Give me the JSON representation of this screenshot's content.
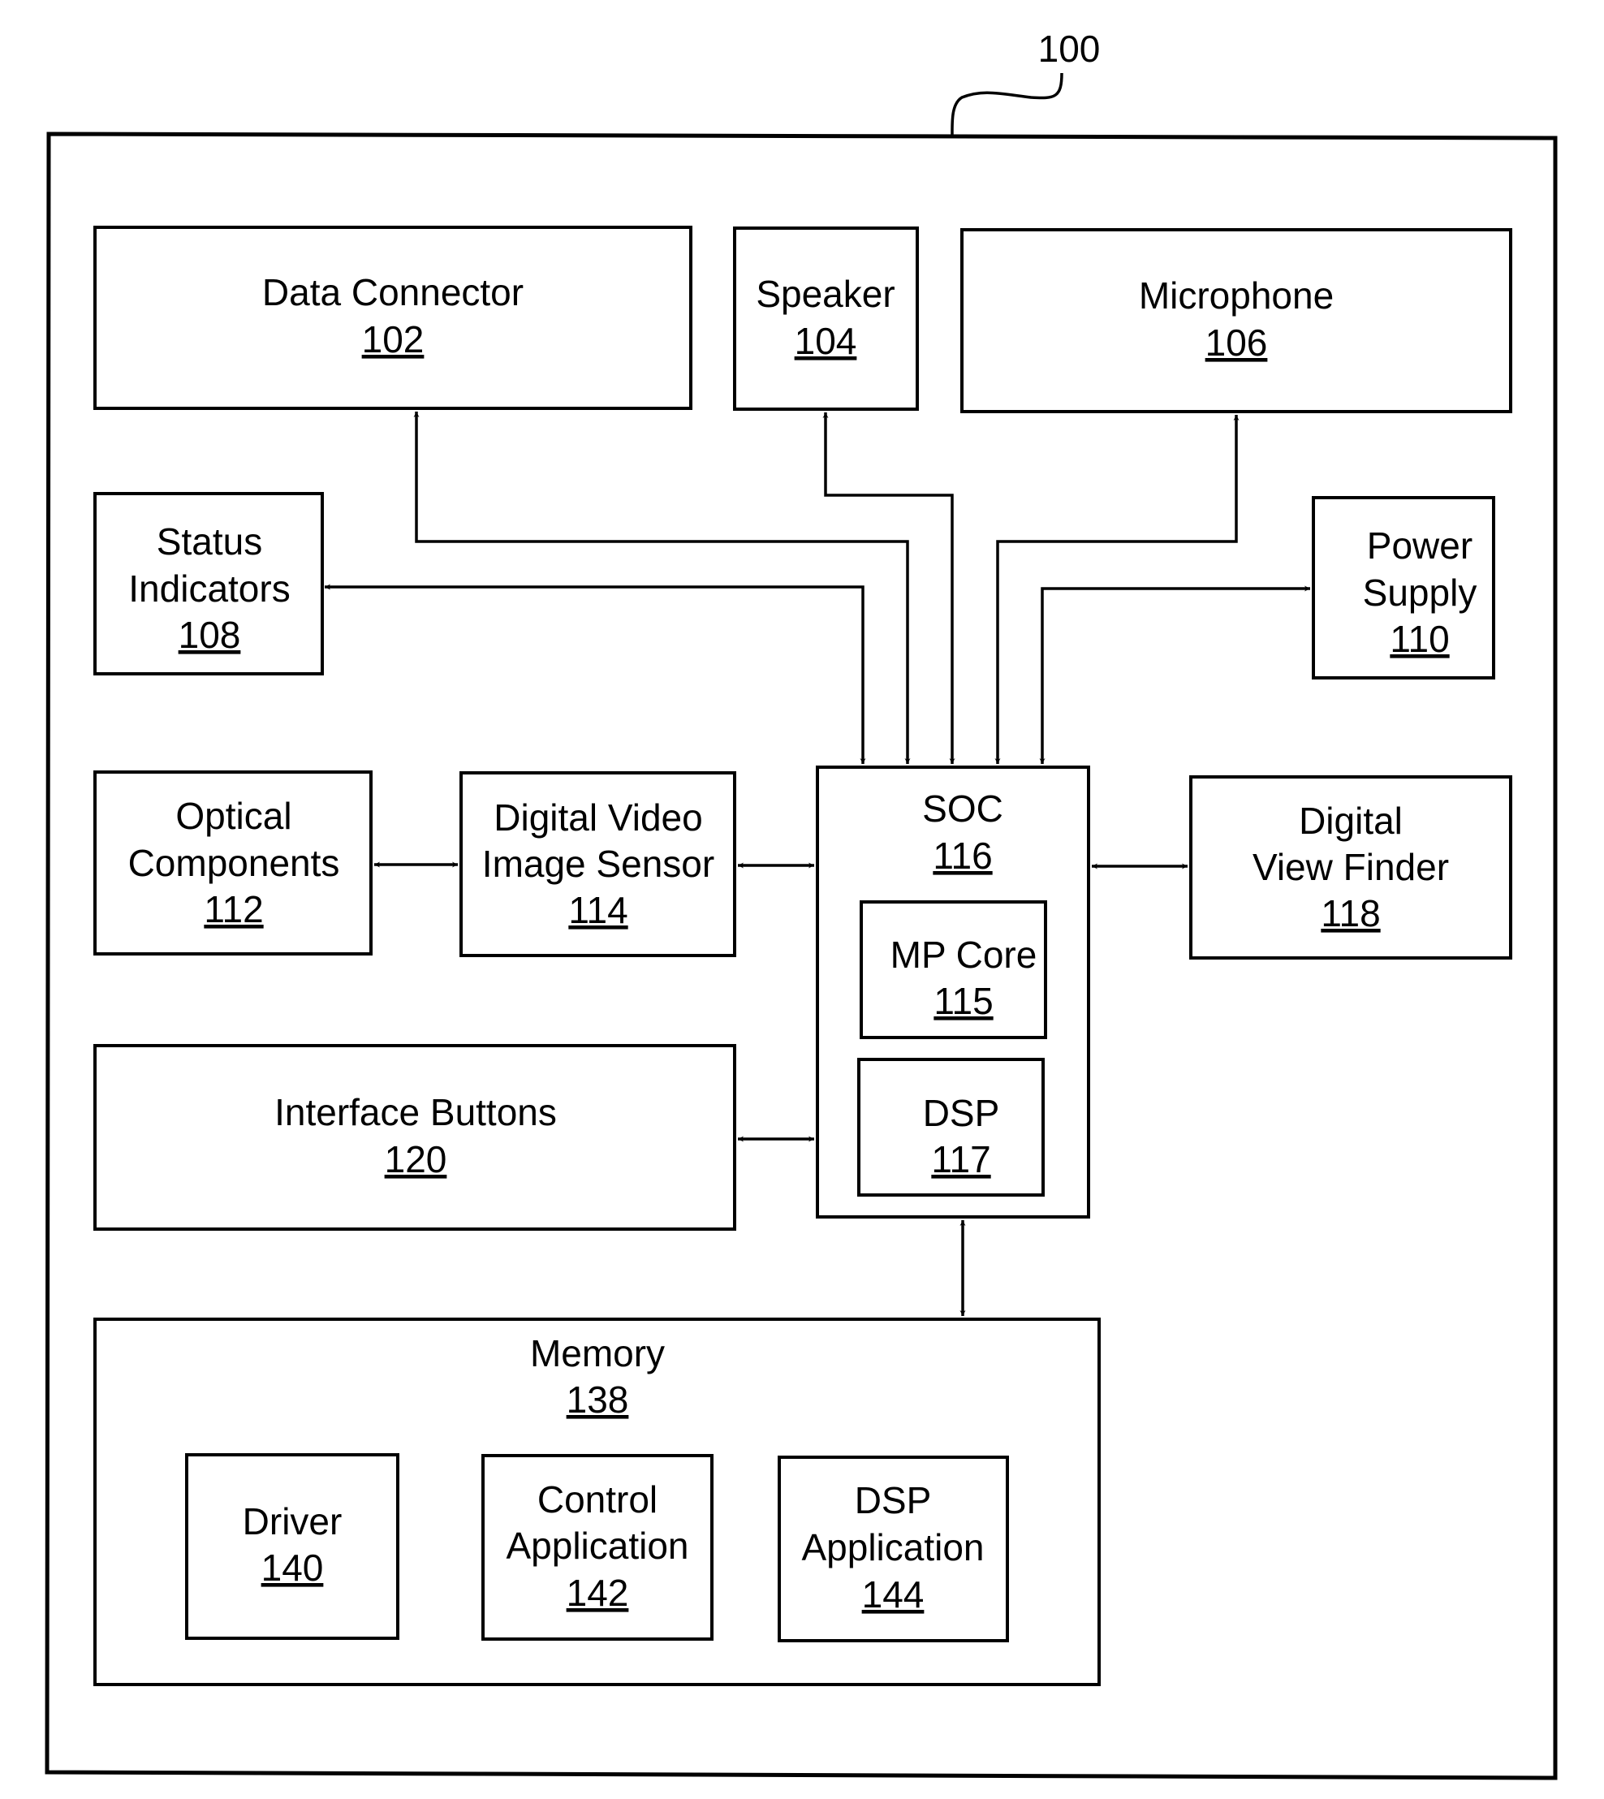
{
  "figure": {
    "reference_number": "100",
    "blocks": {
      "data_connector": {
        "lines": [
          "Data Connector"
        ],
        "number": "102"
      },
      "speaker": {
        "lines": [
          "Speaker"
        ],
        "number": "104"
      },
      "microphone": {
        "lines": [
          "Microphone"
        ],
        "number": "106"
      },
      "status_indicators": {
        "lines": [
          "Status",
          "Indicators"
        ],
        "number": "108"
      },
      "power_supply": {
        "lines": [
          "Power",
          "Supply"
        ],
        "number": "110"
      },
      "optical_components": {
        "lines": [
          "Optical",
          "Components"
        ],
        "number": "112"
      },
      "image_sensor": {
        "lines": [
          "Digital Video",
          "Image Sensor"
        ],
        "number": "114"
      },
      "soc": {
        "lines": [
          "SOC"
        ],
        "number": "116"
      },
      "mp_core": {
        "lines": [
          "MP Core"
        ],
        "number": "115"
      },
      "dsp": {
        "lines": [
          "DSP"
        ],
        "number": "117"
      },
      "view_finder": {
        "lines": [
          "Digital",
          "View Finder"
        ],
        "number": "118"
      },
      "interface_buttons": {
        "lines": [
          "Interface Buttons"
        ],
        "number": "120"
      },
      "memory": {
        "lines": [
          "Memory"
        ],
        "number": "138"
      },
      "driver": {
        "lines": [
          "Driver"
        ],
        "number": "140"
      },
      "control_application": {
        "lines": [
          "Control",
          "Application"
        ],
        "number": "142"
      },
      "dsp_application": {
        "lines": [
          "DSP",
          "Application"
        ],
        "number": "144"
      }
    },
    "connections": [
      {
        "from": "soc",
        "to": "data_connector",
        "direction": "to"
      },
      {
        "from": "soc",
        "to": "speaker",
        "direction": "to"
      },
      {
        "from": "microphone",
        "to": "soc",
        "direction": "to"
      },
      {
        "from": "soc",
        "to": "status_indicators",
        "direction": "to"
      },
      {
        "from": "soc",
        "to": "power_supply",
        "direction": "bidirectional"
      },
      {
        "from": "optical_components",
        "to": "image_sensor",
        "direction": "bidirectional"
      },
      {
        "from": "image_sensor",
        "to": "soc",
        "direction": "bidirectional"
      },
      {
        "from": "soc",
        "to": "view_finder",
        "direction": "bidirectional"
      },
      {
        "from": "interface_buttons",
        "to": "soc",
        "direction": "bidirectional"
      },
      {
        "from": "soc",
        "to": "memory",
        "direction": "bidirectional"
      }
    ]
  }
}
